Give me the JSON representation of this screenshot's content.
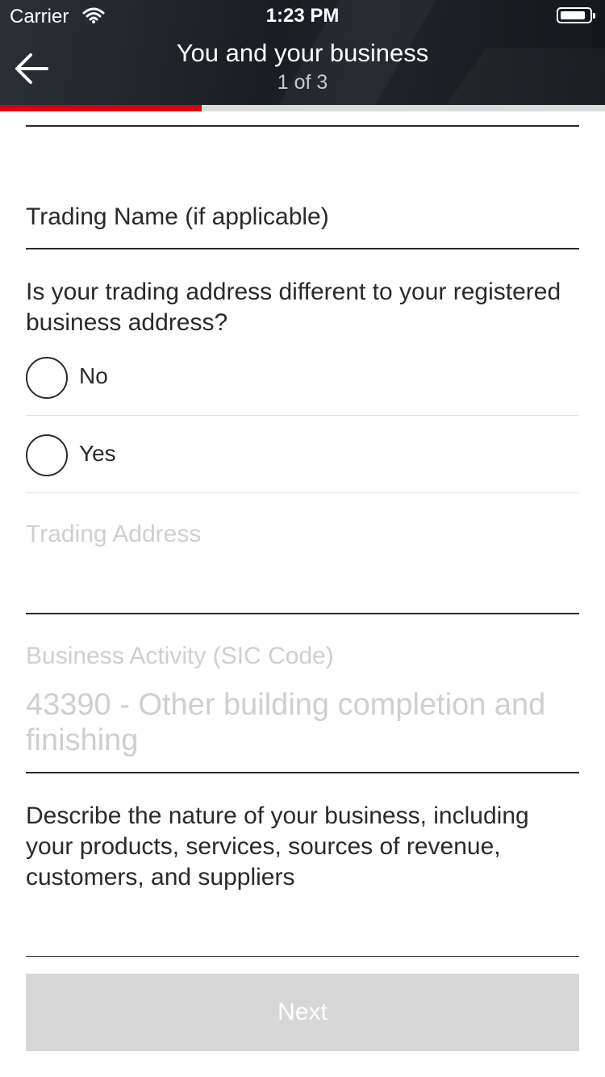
{
  "status_bar": {
    "carrier": "Carrier",
    "time": "1:23 PM"
  },
  "nav": {
    "title": "You and your business",
    "step": "1 of 3",
    "progress": 0.333,
    "accent_color": "#db0011"
  },
  "form": {
    "trading_name_placeholder": "Trading Name (if applicable)",
    "trading_address_question": "Is your trading address different to your registered business address?",
    "options": [
      {
        "label": "No",
        "selected": false
      },
      {
        "label": "Yes",
        "selected": false
      }
    ],
    "trading_address_placeholder": "Trading Address",
    "business_activity_label": "Business Activity (SIC Code)",
    "business_activity_value": "43390 - Other building completion and finishing",
    "business_description_placeholder": "Describe the nature of your business, including your products, services, sources of revenue, customers, and suppliers"
  },
  "actions": {
    "next_label": "Next"
  },
  "icons": {
    "back": "arrow-left-icon",
    "wifi": "wifi-icon",
    "battery": "battery-icon"
  }
}
